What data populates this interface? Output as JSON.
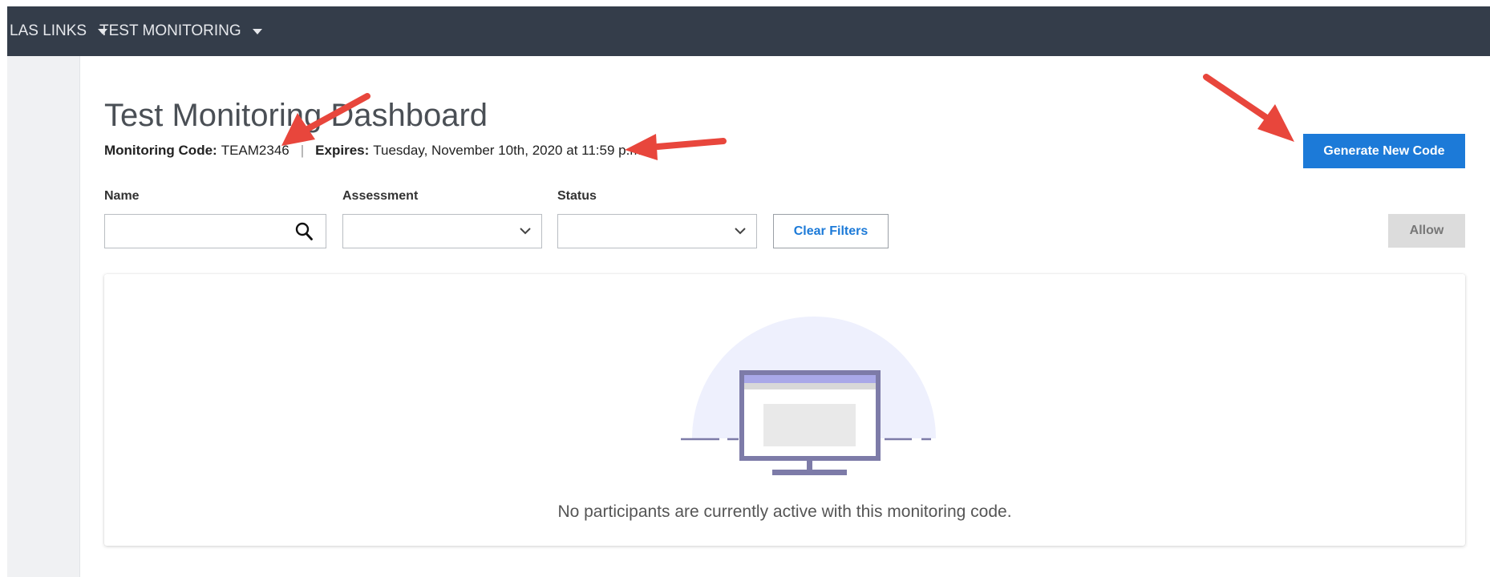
{
  "nav": {
    "items": [
      {
        "label": "LAS LINKS"
      },
      {
        "label": "TEST MONITORING"
      }
    ]
  },
  "page": {
    "title": "Test Monitoring Dashboard",
    "monitoring_code_label": "Monitoring Code:",
    "monitoring_code_value": "TEAM2346",
    "separator": "|",
    "expires_label": "Expires:",
    "expires_value": "Tuesday, November 10th, 2020 at 11:59 p.m."
  },
  "actions": {
    "generate_label": "Generate New Code",
    "clear_filters_label": "Clear Filters",
    "allow_label": "Allow"
  },
  "filters": {
    "name_label": "Name",
    "name_value": "",
    "assessment_label": "Assessment",
    "assessment_value": "",
    "status_label": "Status",
    "status_value": ""
  },
  "empty_state": {
    "message": "No participants are currently active with this monitoring code."
  },
  "colors": {
    "topbar": "#343d4a",
    "primary": "#1c7ad8",
    "annotation_arrow": "#e8463c",
    "illustration_bg": "#eef0fd",
    "illustration_stroke": "#7d7ba8",
    "illustration_band": "#a9a8e8"
  },
  "icons": [
    "caret-down-icon",
    "search-icon",
    "chevron-down-icon",
    "monitor-illustration",
    "annotation-arrow"
  ]
}
